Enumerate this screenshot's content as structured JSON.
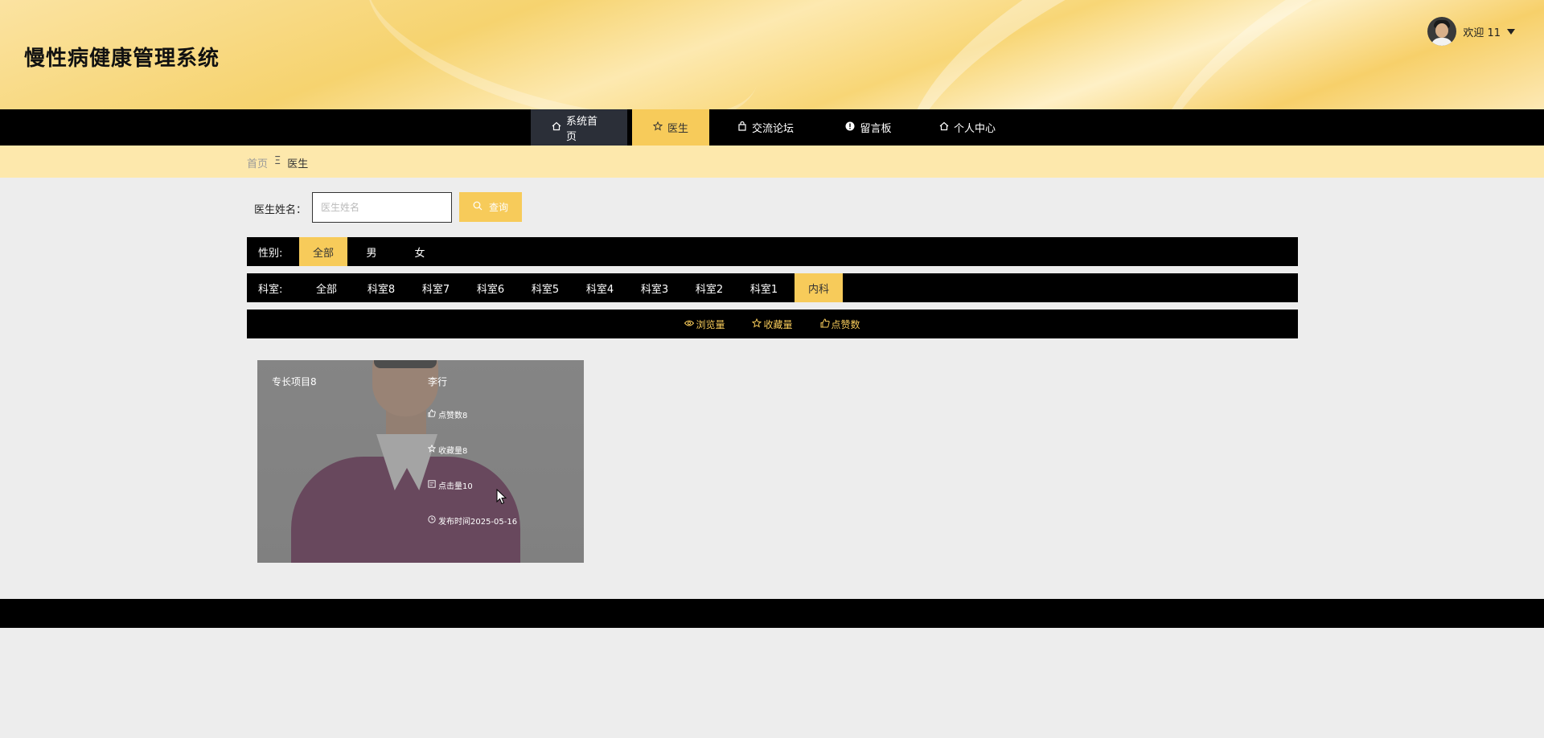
{
  "header": {
    "title": "慢性病健康管理系统",
    "user": {
      "welcome": "欢迎 11"
    }
  },
  "nav": {
    "items": [
      {
        "label": "系统首页",
        "icon": "home-icon"
      },
      {
        "label": "医生",
        "icon": "star-icon"
      },
      {
        "label": "交流论坛",
        "icon": "bag-icon"
      },
      {
        "label": "留言板",
        "icon": "alert-icon"
      },
      {
        "label": "个人中心",
        "icon": "home-icon"
      }
    ],
    "active": "医生"
  },
  "breadcrumb": {
    "home": "首页",
    "separator": "Ξ",
    "current": "医生"
  },
  "search": {
    "label": "医生姓名：",
    "placeholder": "医生姓名",
    "value": "",
    "button": "查询"
  },
  "filters": {
    "gender": {
      "label": "性别:",
      "options": [
        "全部",
        "男",
        "女"
      ],
      "selected": "全部"
    },
    "department": {
      "label": "科室:",
      "options": [
        "全部",
        "科室8",
        "科室7",
        "科室6",
        "科室5",
        "科室4",
        "科室3",
        "科室2",
        "科室1",
        "内科"
      ],
      "selected": "内科"
    }
  },
  "sort": {
    "items": [
      {
        "label": "浏览量",
        "icon": "eye-icon"
      },
      {
        "label": "收藏量",
        "icon": "star-icon"
      },
      {
        "label": "点赞数",
        "icon": "thumb-icon"
      }
    ]
  },
  "doctors": [
    {
      "specialty": "专长项目8",
      "name": "李行",
      "likes": "点赞数8",
      "favorites": "收藏量8",
      "clicks": "点击量10",
      "published": "发布时间2025-05-16"
    }
  ],
  "colors": {
    "accent": "#f7cb5a",
    "bar": "#000000",
    "crumb_bg": "#fde8ac",
    "page_bg": "#ededed"
  }
}
